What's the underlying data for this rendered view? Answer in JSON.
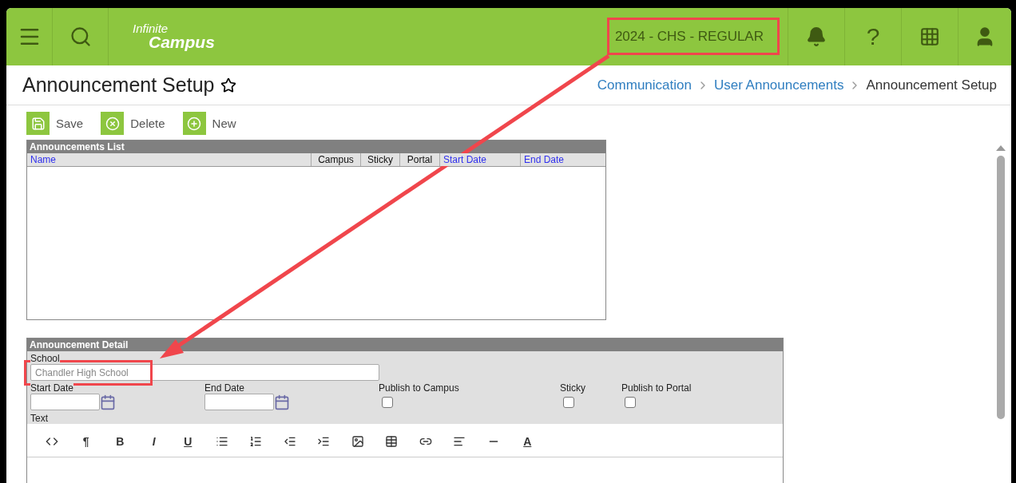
{
  "topbar": {
    "logo": {
      "line1": "Infinite",
      "line2": "Campus"
    },
    "term": "2024 - CHS - REGULAR",
    "help": "?"
  },
  "page": {
    "title": "Announcement Setup",
    "favorite": false,
    "breadcrumbs": [
      {
        "label": "Communication",
        "link": true
      },
      {
        "label": "User Announcements",
        "link": true
      },
      {
        "label": "Announcement Setup",
        "link": false
      }
    ]
  },
  "actions": [
    {
      "kind": "save",
      "label": "Save"
    },
    {
      "kind": "delete",
      "label": "Delete"
    },
    {
      "kind": "new",
      "label": "New"
    }
  ],
  "list": {
    "title": "Announcements List",
    "columns": [
      {
        "label": "Name",
        "sortable": true
      },
      {
        "label": "Campus",
        "sortable": false
      },
      {
        "label": "Sticky",
        "sortable": false
      },
      {
        "label": "Portal",
        "sortable": false
      },
      {
        "label": "Start Date",
        "sortable": true
      },
      {
        "label": "End Date",
        "sortable": true
      }
    ]
  },
  "detail": {
    "title": "Announcement Detail",
    "school": {
      "label": "School",
      "value": "Chandler High School"
    },
    "start_date": {
      "label": "Start Date"
    },
    "end_date": {
      "label": "End Date"
    },
    "checks": [
      {
        "label": "Publish to Campus",
        "checked": false
      },
      {
        "label": "Sticky",
        "checked": false
      },
      {
        "label": "Publish to Portal",
        "checked": false
      }
    ],
    "text_label": "Text",
    "editor_tools": [
      {
        "kind": "source"
      },
      {
        "kind": "glyph",
        "label": "¶"
      },
      {
        "kind": "bold",
        "label": "B"
      },
      {
        "kind": "italic",
        "label": "I"
      },
      {
        "kind": "underline",
        "label": "U"
      },
      {
        "kind": "bullets"
      },
      {
        "kind": "numbers"
      },
      {
        "kind": "outdent"
      },
      {
        "kind": "indent"
      },
      {
        "kind": "image"
      },
      {
        "kind": "table"
      },
      {
        "kind": "link"
      },
      {
        "kind": "align"
      },
      {
        "kind": "rule"
      },
      {
        "kind": "color",
        "label": "A"
      }
    ]
  }
}
